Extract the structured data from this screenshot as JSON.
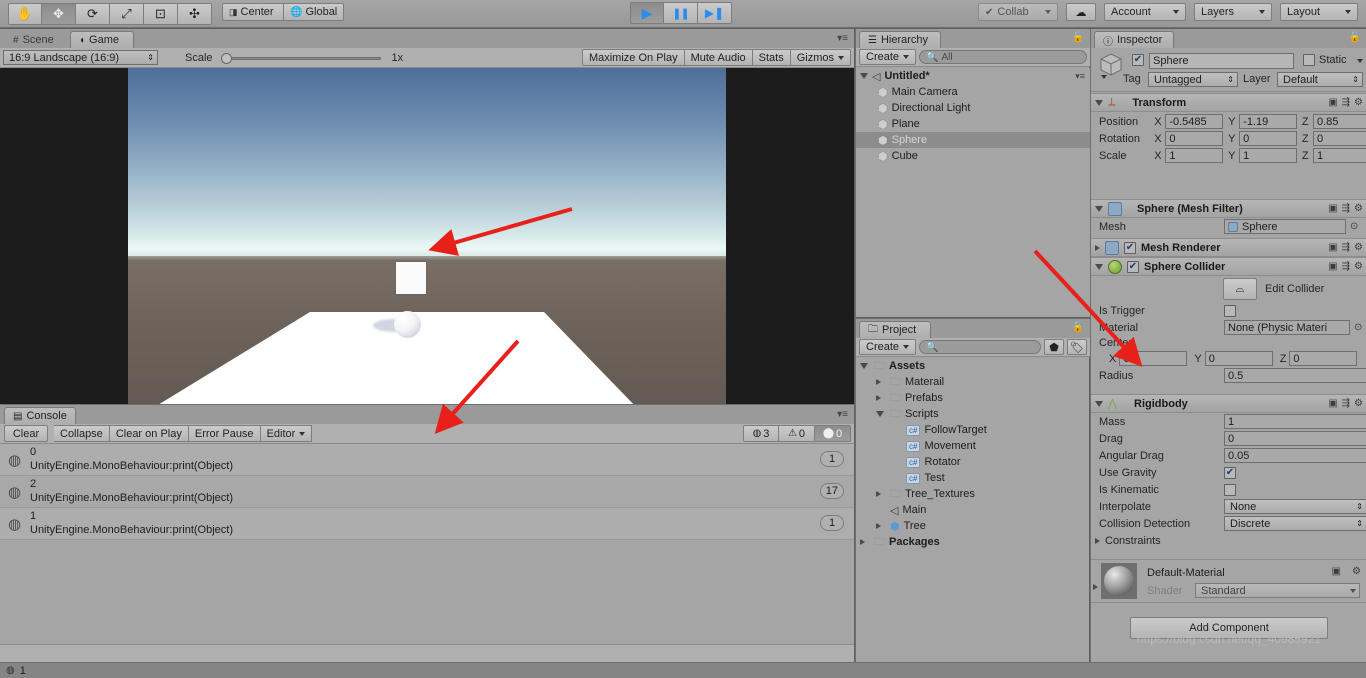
{
  "toolbar": {
    "tools": [
      {
        "name": "hand-tool",
        "glyph": "✋",
        "active": false
      },
      {
        "name": "move-tool",
        "glyph": "✥",
        "active": true
      },
      {
        "name": "rotate-tool",
        "glyph": "⟳",
        "active": false
      },
      {
        "name": "scale-tool",
        "glyph": "⤢",
        "active": false
      },
      {
        "name": "rect-tool",
        "glyph": "⊡",
        "active": false
      },
      {
        "name": "transform-tool",
        "glyph": "✣",
        "active": false
      }
    ],
    "pivot_label": "Center",
    "space_label": "Global",
    "play_label": "▶",
    "pause_label": "❚❚",
    "step_label": "▶❚",
    "collab_label": "Collab",
    "cloud_label": "☁",
    "account_label": "Account",
    "layers_label": "Layers",
    "layout_label": "Layout"
  },
  "gameview": {
    "tabs": [
      {
        "label": "Scene",
        "active": false,
        "icon": "grid-icon"
      },
      {
        "label": "Game",
        "active": true,
        "icon": "gamepad-icon"
      }
    ],
    "aspect_label": "16:9 Landscape (16:9)",
    "scale_label": "Scale",
    "scale_value": "1x",
    "maximize_label": "Maximize On Play",
    "mute_label": "Mute Audio",
    "stats_label": "Stats",
    "gizmos_label": "Gizmos"
  },
  "hierarchy": {
    "tab_label": "Hierarchy",
    "create_label": "Create",
    "search_placeholder": "All",
    "scene_name": "Untitled*",
    "items": [
      {
        "label": "Main Camera",
        "selected": false
      },
      {
        "label": "Directional Light",
        "selected": false
      },
      {
        "label": "Plane",
        "selected": false
      },
      {
        "label": "Sphere",
        "selected": true
      },
      {
        "label": "Cube",
        "selected": false
      }
    ]
  },
  "project": {
    "tab_label": "Project",
    "create_label": "Create",
    "search_placeholder": "",
    "tree": [
      {
        "label": "Assets",
        "depth": 0,
        "type": "folder",
        "state": "open",
        "bold": true
      },
      {
        "label": "Materail",
        "depth": 1,
        "type": "folder",
        "state": "closed",
        "bold": false
      },
      {
        "label": "Prefabs",
        "depth": 1,
        "type": "folder",
        "state": "closed",
        "bold": false
      },
      {
        "label": "Scripts",
        "depth": 1,
        "type": "folder",
        "state": "open",
        "bold": false
      },
      {
        "label": "FollowTarget",
        "depth": 2,
        "type": "script",
        "state": "leaf",
        "bold": false
      },
      {
        "label": "Movement",
        "depth": 2,
        "type": "script",
        "state": "leaf",
        "bold": false
      },
      {
        "label": "Rotator",
        "depth": 2,
        "type": "script",
        "state": "leaf",
        "bold": false
      },
      {
        "label": "Test",
        "depth": 2,
        "type": "script",
        "state": "leaf",
        "bold": false
      },
      {
        "label": "Tree_Textures",
        "depth": 1,
        "type": "folder",
        "state": "closed",
        "bold": false
      },
      {
        "label": "Main",
        "depth": 1,
        "type": "scene",
        "state": "leaf",
        "bold": false
      },
      {
        "label": "Tree",
        "depth": 1,
        "type": "prefab",
        "state": "closed",
        "bold": false
      },
      {
        "label": "Packages",
        "depth": 0,
        "type": "folder",
        "state": "closed",
        "bold": true
      }
    ]
  },
  "console": {
    "tab_label": "Console",
    "clear_label": "Clear",
    "collapse_label": "Collapse",
    "clear_on_play_label": "Clear on Play",
    "error_pause_label": "Error Pause",
    "editor_label": "Editor",
    "counts": {
      "info": "3",
      "warning": "0",
      "error": "0"
    },
    "entries": [
      {
        "title": "0",
        "detail": "UnityEngine.MonoBehaviour:print(Object)",
        "count": "1"
      },
      {
        "title": "2",
        "detail": "UnityEngine.MonoBehaviour:print(Object)",
        "count": "17"
      },
      {
        "title": "1",
        "detail": "UnityEngine.MonoBehaviour:print(Object)",
        "count": "1"
      }
    ]
  },
  "inspector": {
    "tab_label": "Inspector",
    "object_name": "Sphere",
    "static_label": "Static",
    "tag_label": "Tag",
    "tag_value": "Untagged",
    "layer_label": "Layer",
    "layer_value": "Default",
    "transform": {
      "title": "Transform",
      "rows": [
        {
          "label": "Position",
          "x": "-0.5485",
          "y": "-1.19",
          "z": "0.85"
        },
        {
          "label": "Rotation",
          "x": "0",
          "y": "0",
          "z": "0"
        },
        {
          "label": "Scale",
          "x": "1",
          "y": "1",
          "z": "1"
        }
      ]
    },
    "mesh_filter": {
      "title": "Sphere (Mesh Filter)",
      "mesh_label": "Mesh",
      "mesh_value": "Sphere"
    },
    "mesh_renderer": {
      "title": "Mesh Renderer",
      "enabled": true
    },
    "sphere_collider": {
      "title": "Sphere Collider",
      "enabled": true,
      "edit_collider_label": "Edit Collider",
      "is_trigger_label": "Is Trigger",
      "is_trigger_value": false,
      "material_label": "Material",
      "material_value": "None (Physic Materi",
      "center_label": "Center",
      "center_x": "0",
      "center_y": "0",
      "center_z": "0",
      "radius_label": "Radius",
      "radius_value": "0.5"
    },
    "rigidbody": {
      "title": "Rigidbody",
      "mass_label": "Mass",
      "mass_value": "1",
      "drag_label": "Drag",
      "drag_value": "0",
      "angular_drag_label": "Angular Drag",
      "angular_drag_value": "0.05",
      "use_gravity_label": "Use Gravity",
      "use_gravity_value": true,
      "is_kinematic_label": "Is Kinematic",
      "is_kinematic_value": false,
      "interpolate_label": "Interpolate",
      "interpolate_value": "None",
      "collision_detection_label": "Collision Detection",
      "collision_detection_value": "Discrete",
      "constraints_label": "Constraints"
    },
    "material": {
      "title": "Default-Material",
      "shader_label": "Shader",
      "shader_value": "Standard"
    },
    "add_component_label": "Add Component"
  },
  "statusbar": {
    "message": "1"
  },
  "watermark": "https://blog.csdn.net/qq_40985921",
  "colors": {
    "accent_blue": "#2a8cf0",
    "arrow_red": "#e8201a",
    "panel_bg": "#a5a5a5",
    "selection": "#8c8c8c"
  }
}
